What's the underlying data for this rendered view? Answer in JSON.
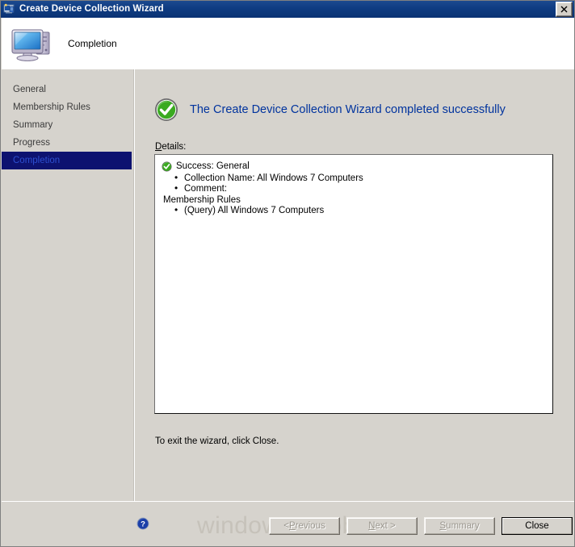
{
  "window": {
    "title": "Create Device Collection Wizard",
    "title_icon": "collection-wizard-icon",
    "close_icon": "close-icon"
  },
  "header": {
    "title": "Completion",
    "icon": "computer-icon"
  },
  "sidebar": {
    "items": [
      {
        "label": "General",
        "selected": false
      },
      {
        "label": "Membership Rules",
        "selected": false
      },
      {
        "label": "Summary",
        "selected": false
      },
      {
        "label": "Progress",
        "selected": false
      },
      {
        "label": "Completion",
        "selected": true
      }
    ]
  },
  "content": {
    "result_icon": "success-check-icon",
    "result_title": "The Create Device Collection Wizard completed successfully",
    "details_label": "Details:",
    "details_label_accel": "D",
    "details_label_rest": "etails:",
    "details": [
      {
        "type": "head",
        "icon": "success-check-icon",
        "text": "Success: General"
      },
      {
        "type": "bullet",
        "text": "Collection Name: All Windows 7 Computers"
      },
      {
        "type": "bullet",
        "text": "Comment:"
      },
      {
        "type": "plain",
        "text": "Membership Rules"
      },
      {
        "type": "bullet",
        "text": "(Query) All Windows 7 Computers"
      }
    ],
    "exit_hint": "To exit the wizard, click Close."
  },
  "footer": {
    "help_icon": "help-icon",
    "watermark": "windows-noob.com",
    "buttons": [
      {
        "name": "previous-button",
        "accel": "P",
        "before": "< ",
        "after": "revious",
        "label": "< Previous",
        "disabled": true,
        "default": false
      },
      {
        "name": "next-button",
        "accel": "N",
        "before": "",
        "after": "ext >",
        "label": "Next >",
        "disabled": true,
        "default": false
      },
      {
        "name": "summary-button",
        "accel": "S",
        "before": "",
        "after": "ummary",
        "label": "Summary",
        "disabled": true,
        "default": false
      },
      {
        "name": "close-button",
        "accel": "",
        "before": "",
        "after": "",
        "label": "Close",
        "disabled": false,
        "default": true
      }
    ]
  },
  "colors": {
    "titlebar_blue": "#0f3c82",
    "face": "#d6d3cd",
    "heading_blue": "#00339e",
    "selection_navy": "#0d1270",
    "selection_text": "#2d4fd0",
    "success_green": "#3aaa20",
    "watermark_gray": "#c6c2ba"
  }
}
